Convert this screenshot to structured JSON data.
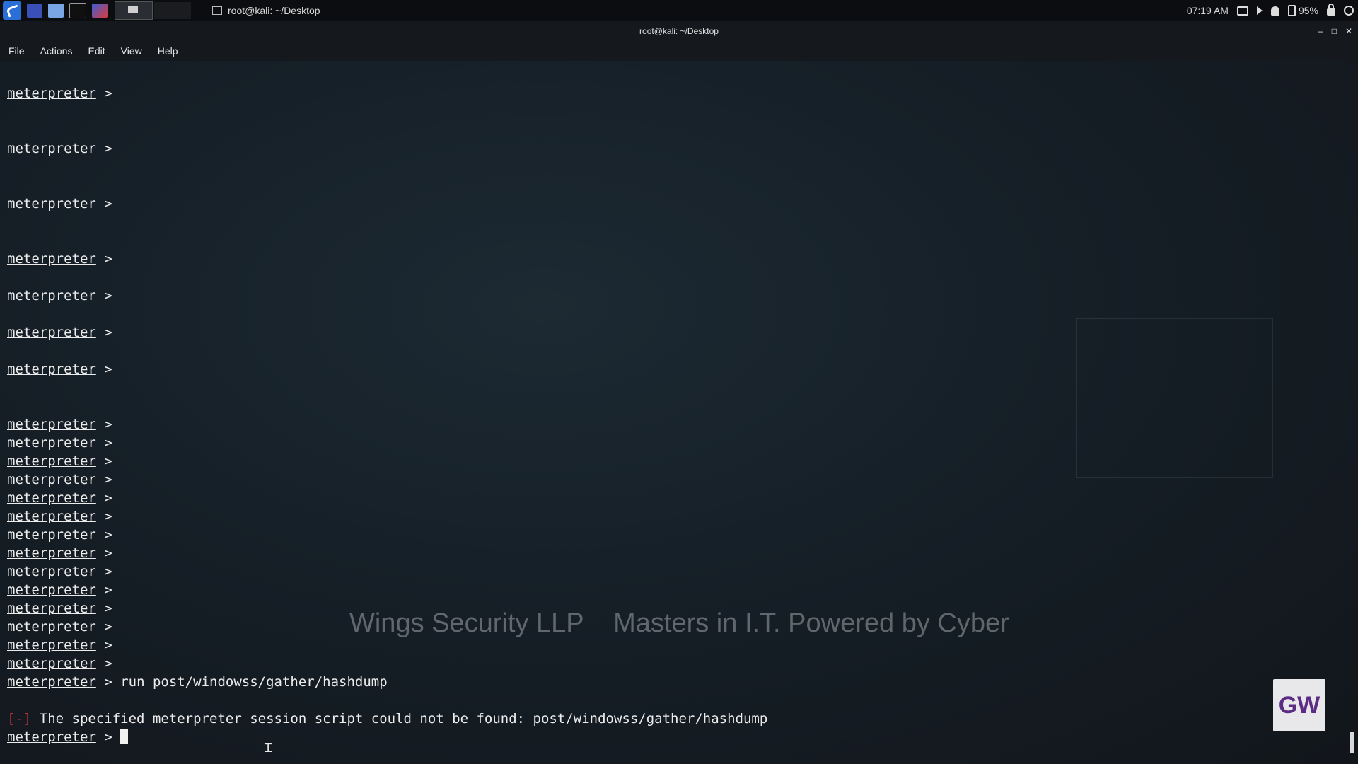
{
  "taskbar": {
    "task_title": "root@kali: ~/Desktop",
    "clock": "07:19 AM",
    "battery": "95%"
  },
  "window": {
    "title": "root@kali: ~/Desktop",
    "controls": [
      "–",
      "□",
      "✕"
    ]
  },
  "menu": [
    "File",
    "Actions",
    "Edit",
    "View",
    "Help"
  ],
  "terminal": {
    "prompt": "meterpreter",
    "prompt_suffix": " >",
    "command": "run post/windowss/gather/hashdump",
    "error_tag": "[-]",
    "error_message": "The specified meterpreter session script could not be found: post/windowss/gather/hashdump"
  },
  "watermark": "Wings Security LLP    Masters in I.T. Powered by Cyber",
  "logo_text": "GW"
}
